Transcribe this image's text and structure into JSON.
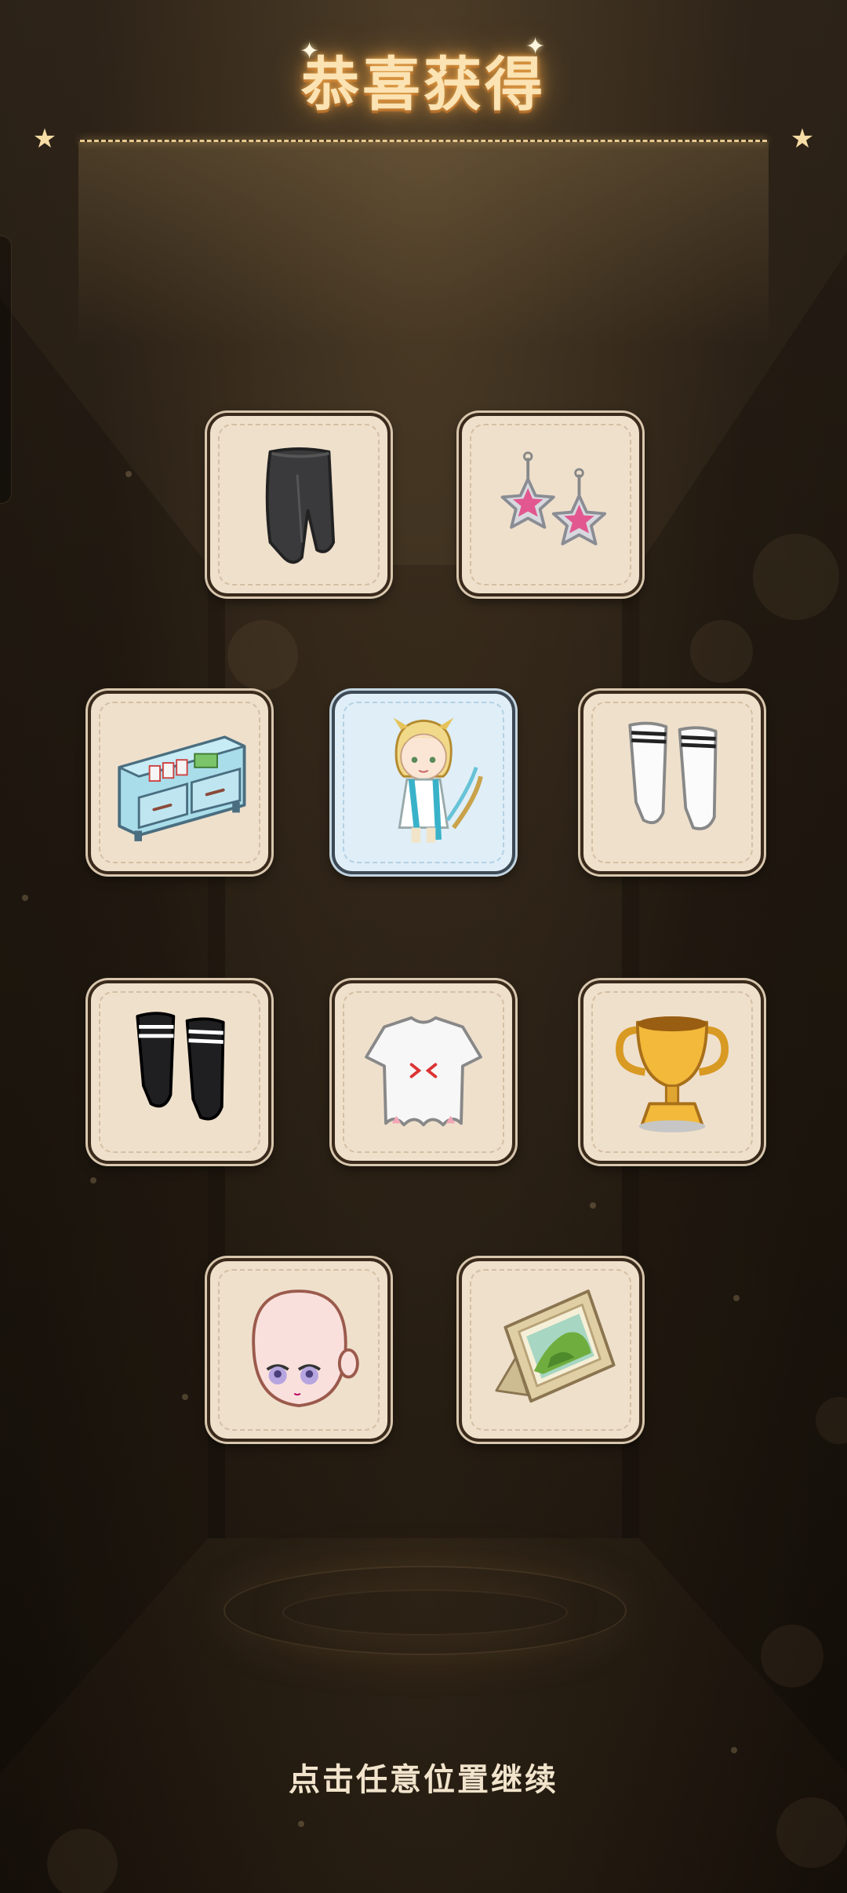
{
  "header": {
    "title": "恭喜获得"
  },
  "items": [
    {
      "name": "black-pants",
      "icon": "pants-icon"
    },
    {
      "name": "star-earrings",
      "icon": "earrings-icon"
    },
    {
      "name": "light-blue-cabinet",
      "icon": "cabinet-icon"
    },
    {
      "name": "character-outfit",
      "icon": "character-icon",
      "featured": true
    },
    {
      "name": "white-socks",
      "icon": "socks-icon"
    },
    {
      "name": "black-socks",
      "icon": "socks-icon"
    },
    {
      "name": "white-ghost-top",
      "icon": "shirt-icon"
    },
    {
      "name": "golden-trophy",
      "icon": "trophy-icon"
    },
    {
      "name": "bald-head-face",
      "icon": "face-icon"
    },
    {
      "name": "picture-frame",
      "icon": "frame-icon"
    }
  ],
  "footer": {
    "hint": "点击任意位置继续"
  },
  "colors": {
    "background": "#1b140d",
    "card": "#efe0cc",
    "featured_card": "#dfeef7",
    "title": "#fbe3b4",
    "hint": "#f2e4cc"
  }
}
